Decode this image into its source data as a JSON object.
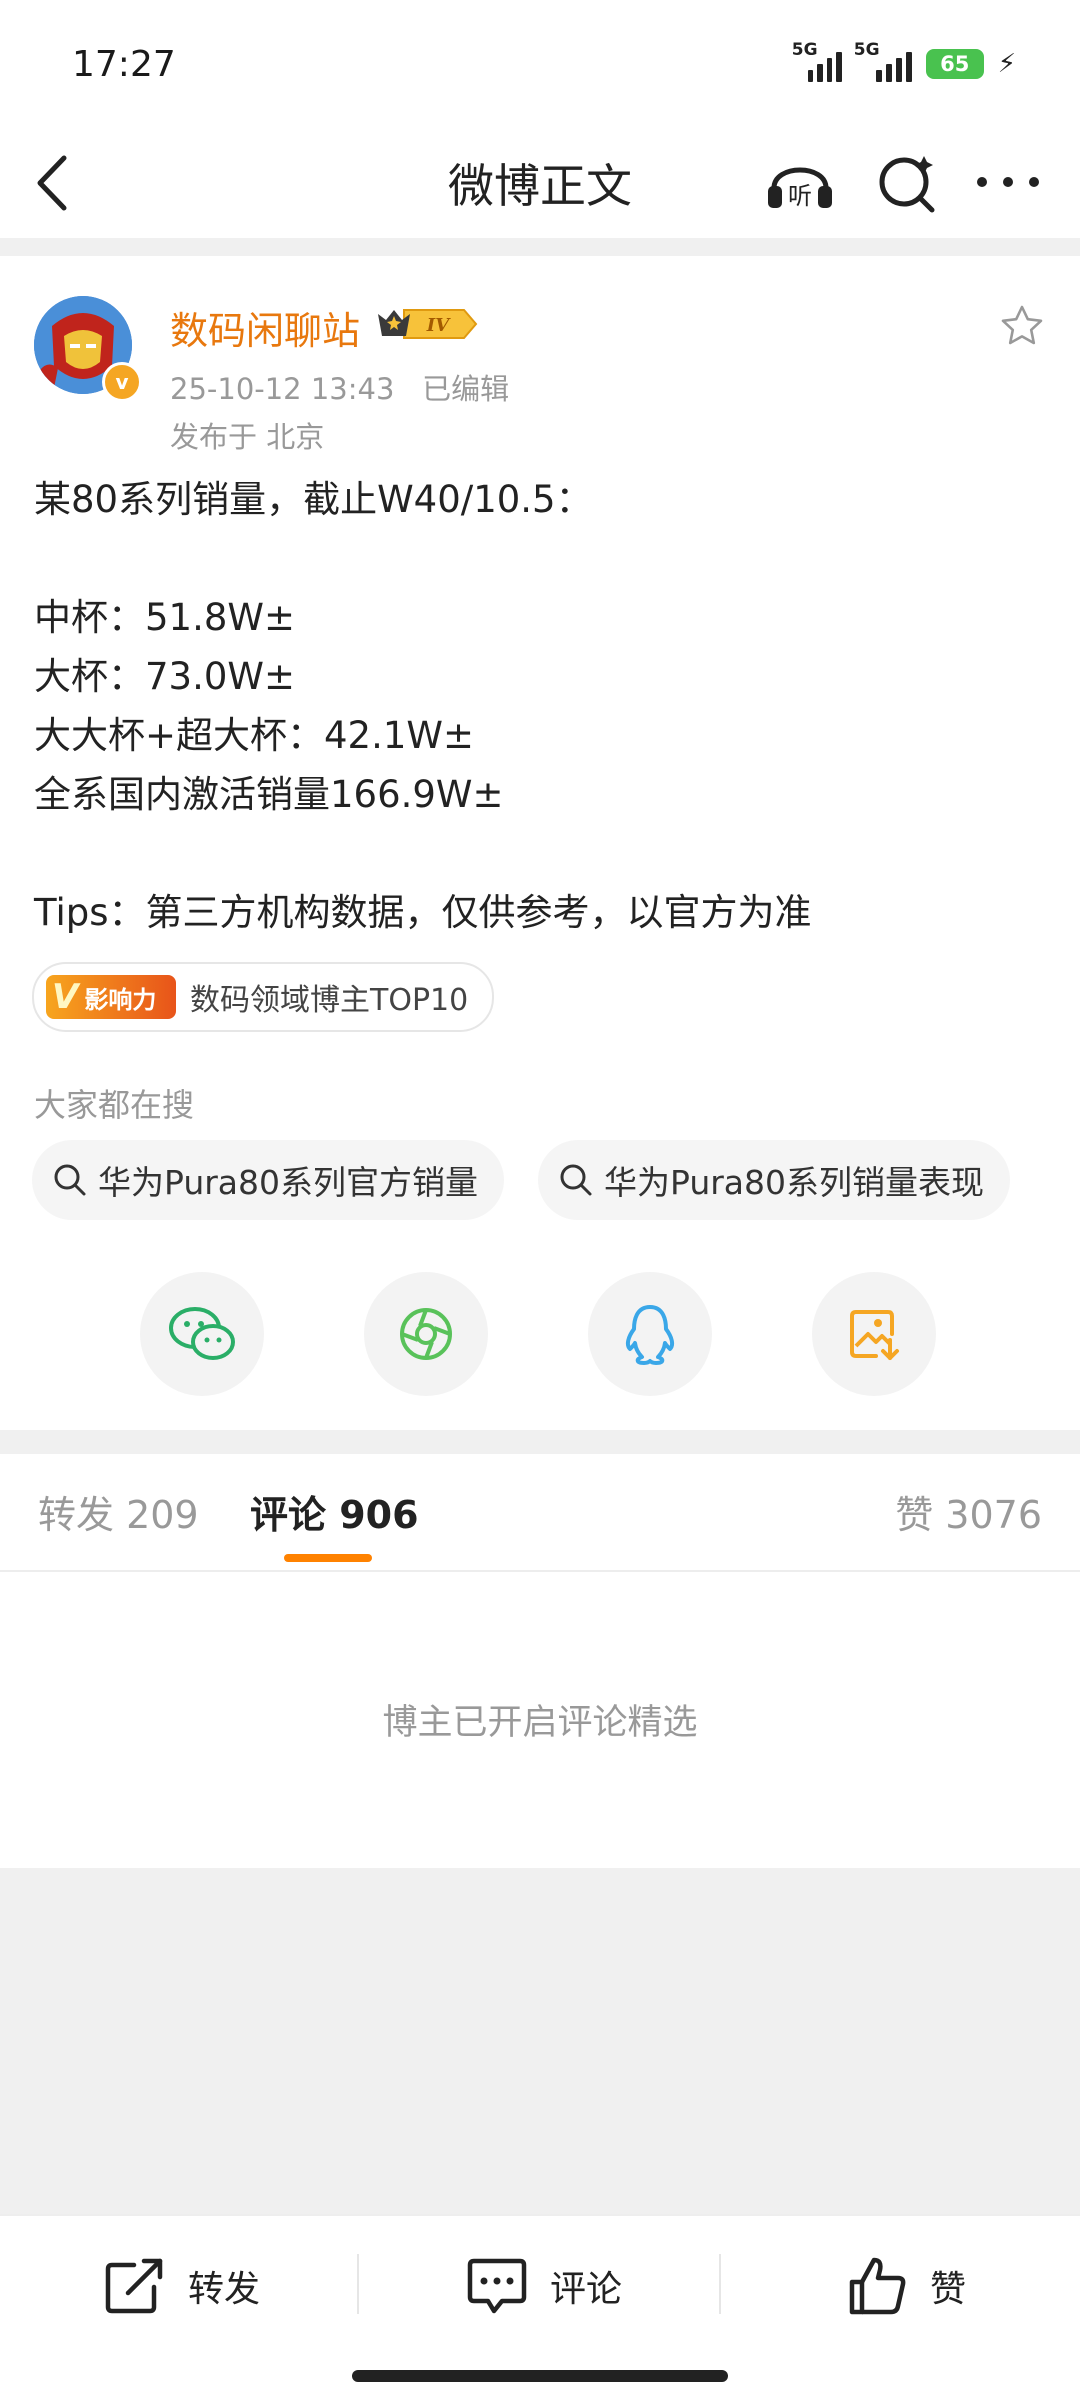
{
  "status_bar": {
    "time": "17:27",
    "signal1_label": "5G",
    "signal2_label": "5G",
    "battery": "65",
    "icons": [
      "signal-icon",
      "signal-icon",
      "battery-icon",
      "charging-icon"
    ]
  },
  "header": {
    "title": "微博正文",
    "icons": [
      "back-icon",
      "listen-icon",
      "search-icon",
      "more-icon"
    ],
    "listen_label": "听"
  },
  "post": {
    "username": "数码闲聊站",
    "rank_badge": "IV",
    "verified_badge": "v",
    "time": "25-10-12 13:43",
    "edited": "已编辑",
    "location": "发布于 北京",
    "lines": [
      "某80系列销量，截止W40/10.5：",
      "",
      "中杯：51.8W±",
      "大杯：73.0W±",
      "大大杯+超大杯：42.1W±",
      "全系国内激活销量166.9W±",
      "",
      "Tips：第三方机构数据，仅供参考，以官方为准"
    ],
    "influence_badge_v": "V",
    "influence_badge_text": "影响力",
    "influence_text": "数码领域博主TOP10"
  },
  "search": {
    "title": "大家都在搜",
    "chips": [
      "华为Pura80系列官方销量",
      "华为Pura80系列销量表现"
    ]
  },
  "share_icons": [
    "wechat-icon",
    "moments-icon",
    "qq-icon",
    "save-image-icon"
  ],
  "colors": {
    "accent": "#ff8200",
    "username": "#e8780e",
    "wechat": "#2aae67",
    "moments": "#59c25a",
    "qq": "#3aa7e8",
    "save_image": "#f5a623"
  },
  "tabs": {
    "repost": "转发 209",
    "comment": "评论 906",
    "like": "赞 3076",
    "active": "comment"
  },
  "comments": {
    "note": "博主已开启评论精选"
  },
  "bottom_bar": {
    "repost": "转发",
    "comment": "评论",
    "like": "赞"
  }
}
